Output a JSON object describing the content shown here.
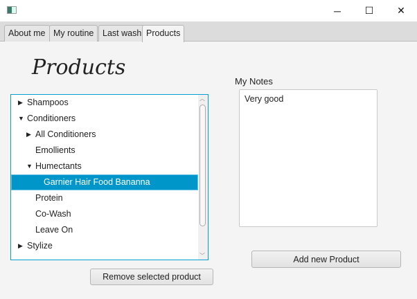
{
  "window": {
    "controls": {
      "minimize": "─",
      "maximize": "☐",
      "close": "✕"
    }
  },
  "tabs": [
    {
      "label": "About me"
    },
    {
      "label": "My routine"
    },
    {
      "label": "Last wash"
    },
    {
      "label": "Products"
    }
  ],
  "page_title": "Products",
  "tree": {
    "rows": [
      {
        "label": "Shampoos",
        "arrow": "▶"
      },
      {
        "label": "Conditioners",
        "arrow": "▼"
      },
      {
        "label": "All Conditioners",
        "arrow": "▶"
      },
      {
        "label": "Emollients",
        "arrow": ""
      },
      {
        "label": "Humectants",
        "arrow": "▼"
      },
      {
        "label": "Garnier Hair Food Bananna",
        "arrow": ""
      },
      {
        "label": "Protein",
        "arrow": ""
      },
      {
        "label": "Co-Wash",
        "arrow": ""
      },
      {
        "label": "Leave On",
        "arrow": ""
      },
      {
        "label": "Stylize",
        "arrow": "▶"
      }
    ]
  },
  "notes": {
    "label": "My Notes",
    "value": "Very good"
  },
  "buttons": {
    "add": "Add new Product",
    "remove": "Remove selected product"
  },
  "colors": {
    "selection": "#0096c9",
    "focus_border": "#039ed3"
  }
}
